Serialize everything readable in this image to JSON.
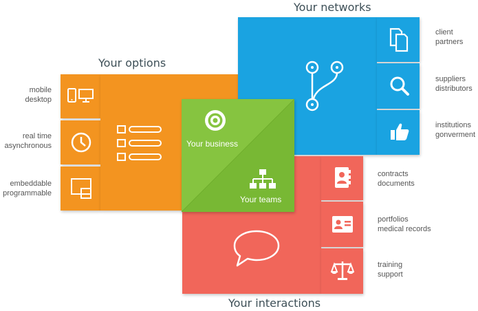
{
  "headings": {
    "options": "Your options",
    "networks": "Your networks",
    "interactions": "Your interactions"
  },
  "center": {
    "business": "Your business",
    "teams": "Your teams"
  },
  "options": [
    {
      "icon": "devices-icon",
      "lines": [
        "mobile",
        "desktop"
      ]
    },
    {
      "icon": "clock-icon",
      "lines": [
        "real time",
        "asynchronous"
      ]
    },
    {
      "icon": "embed-window-icon",
      "lines": [
        "embeddable",
        "programmable"
      ]
    }
  ],
  "networks": [
    {
      "icon": "documents-icon",
      "lines": [
        "client",
        "partners"
      ]
    },
    {
      "icon": "search-icon",
      "lines": [
        "suppliers",
        "distributors"
      ]
    },
    {
      "icon": "thumbs-up-icon",
      "lines": [
        "institutions",
        "gonverment"
      ]
    }
  ],
  "interactions": [
    {
      "icon": "contacts-book-icon",
      "lines": [
        "contracts",
        "documents"
      ]
    },
    {
      "icon": "id-card-icon",
      "lines": [
        "portfolios",
        "medical records"
      ]
    },
    {
      "icon": "scales-icon",
      "lines": [
        "training",
        "support"
      ]
    }
  ],
  "colors": {
    "orange": "#f39420",
    "blue": "#1aa3e1",
    "red": "#f1665a",
    "green": "#86c440",
    "heading": "#3d4f57"
  }
}
